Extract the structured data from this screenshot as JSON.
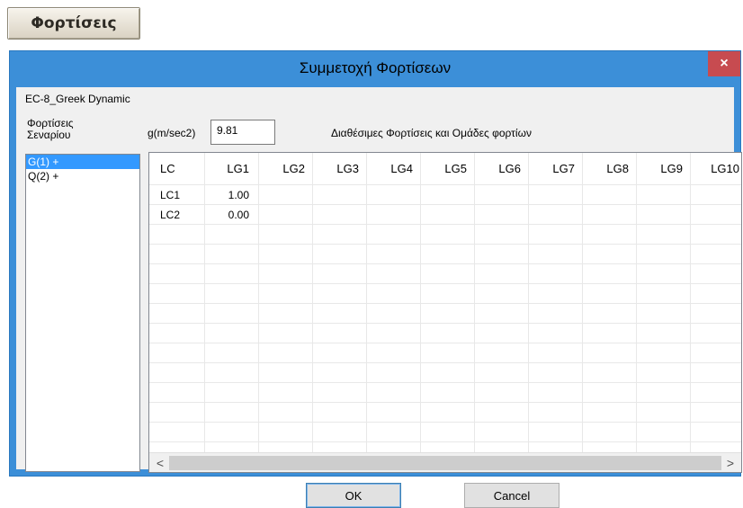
{
  "top_button": {
    "label": "Φορτίσεις"
  },
  "dialog": {
    "title": "Συμμετοχή Φορτίσεων",
    "close_glyph": "×",
    "scenario_name": "EC-8_Greek Dynamic",
    "scenario_loads_label": "Φορτίσεις Σεναρίου",
    "gravity_label": "g(m/sec2)",
    "gravity_value": "9.81",
    "available_label": "Διαθέσιμες Φορτίσεις και Ομάδες φορτίων",
    "scenario_list": [
      {
        "label": "G(1) +",
        "selected": true
      },
      {
        "label": "Q(2) +",
        "selected": false
      }
    ],
    "grid": {
      "columns": [
        "LC",
        "LG1",
        "LG2",
        "LG3",
        "LG4",
        "LG5",
        "LG6",
        "LG7",
        "LG8",
        "LG9",
        "LG10"
      ],
      "rows": [
        [
          "LC1",
          "1.00",
          "",
          "",
          "",
          "",
          "",
          "",
          "",
          "",
          ""
        ],
        [
          "LC2",
          "0.00",
          "",
          "",
          "",
          "",
          "",
          "",
          "",
          "",
          ""
        ]
      ],
      "scroll_left_glyph": "<",
      "scroll_right_glyph": ">"
    },
    "ok_label": "OK",
    "cancel_label": "Cancel",
    "colors": {
      "titlebar": "#3c8fd8",
      "close": "#c74b50",
      "selection": "#3399ff"
    }
  }
}
